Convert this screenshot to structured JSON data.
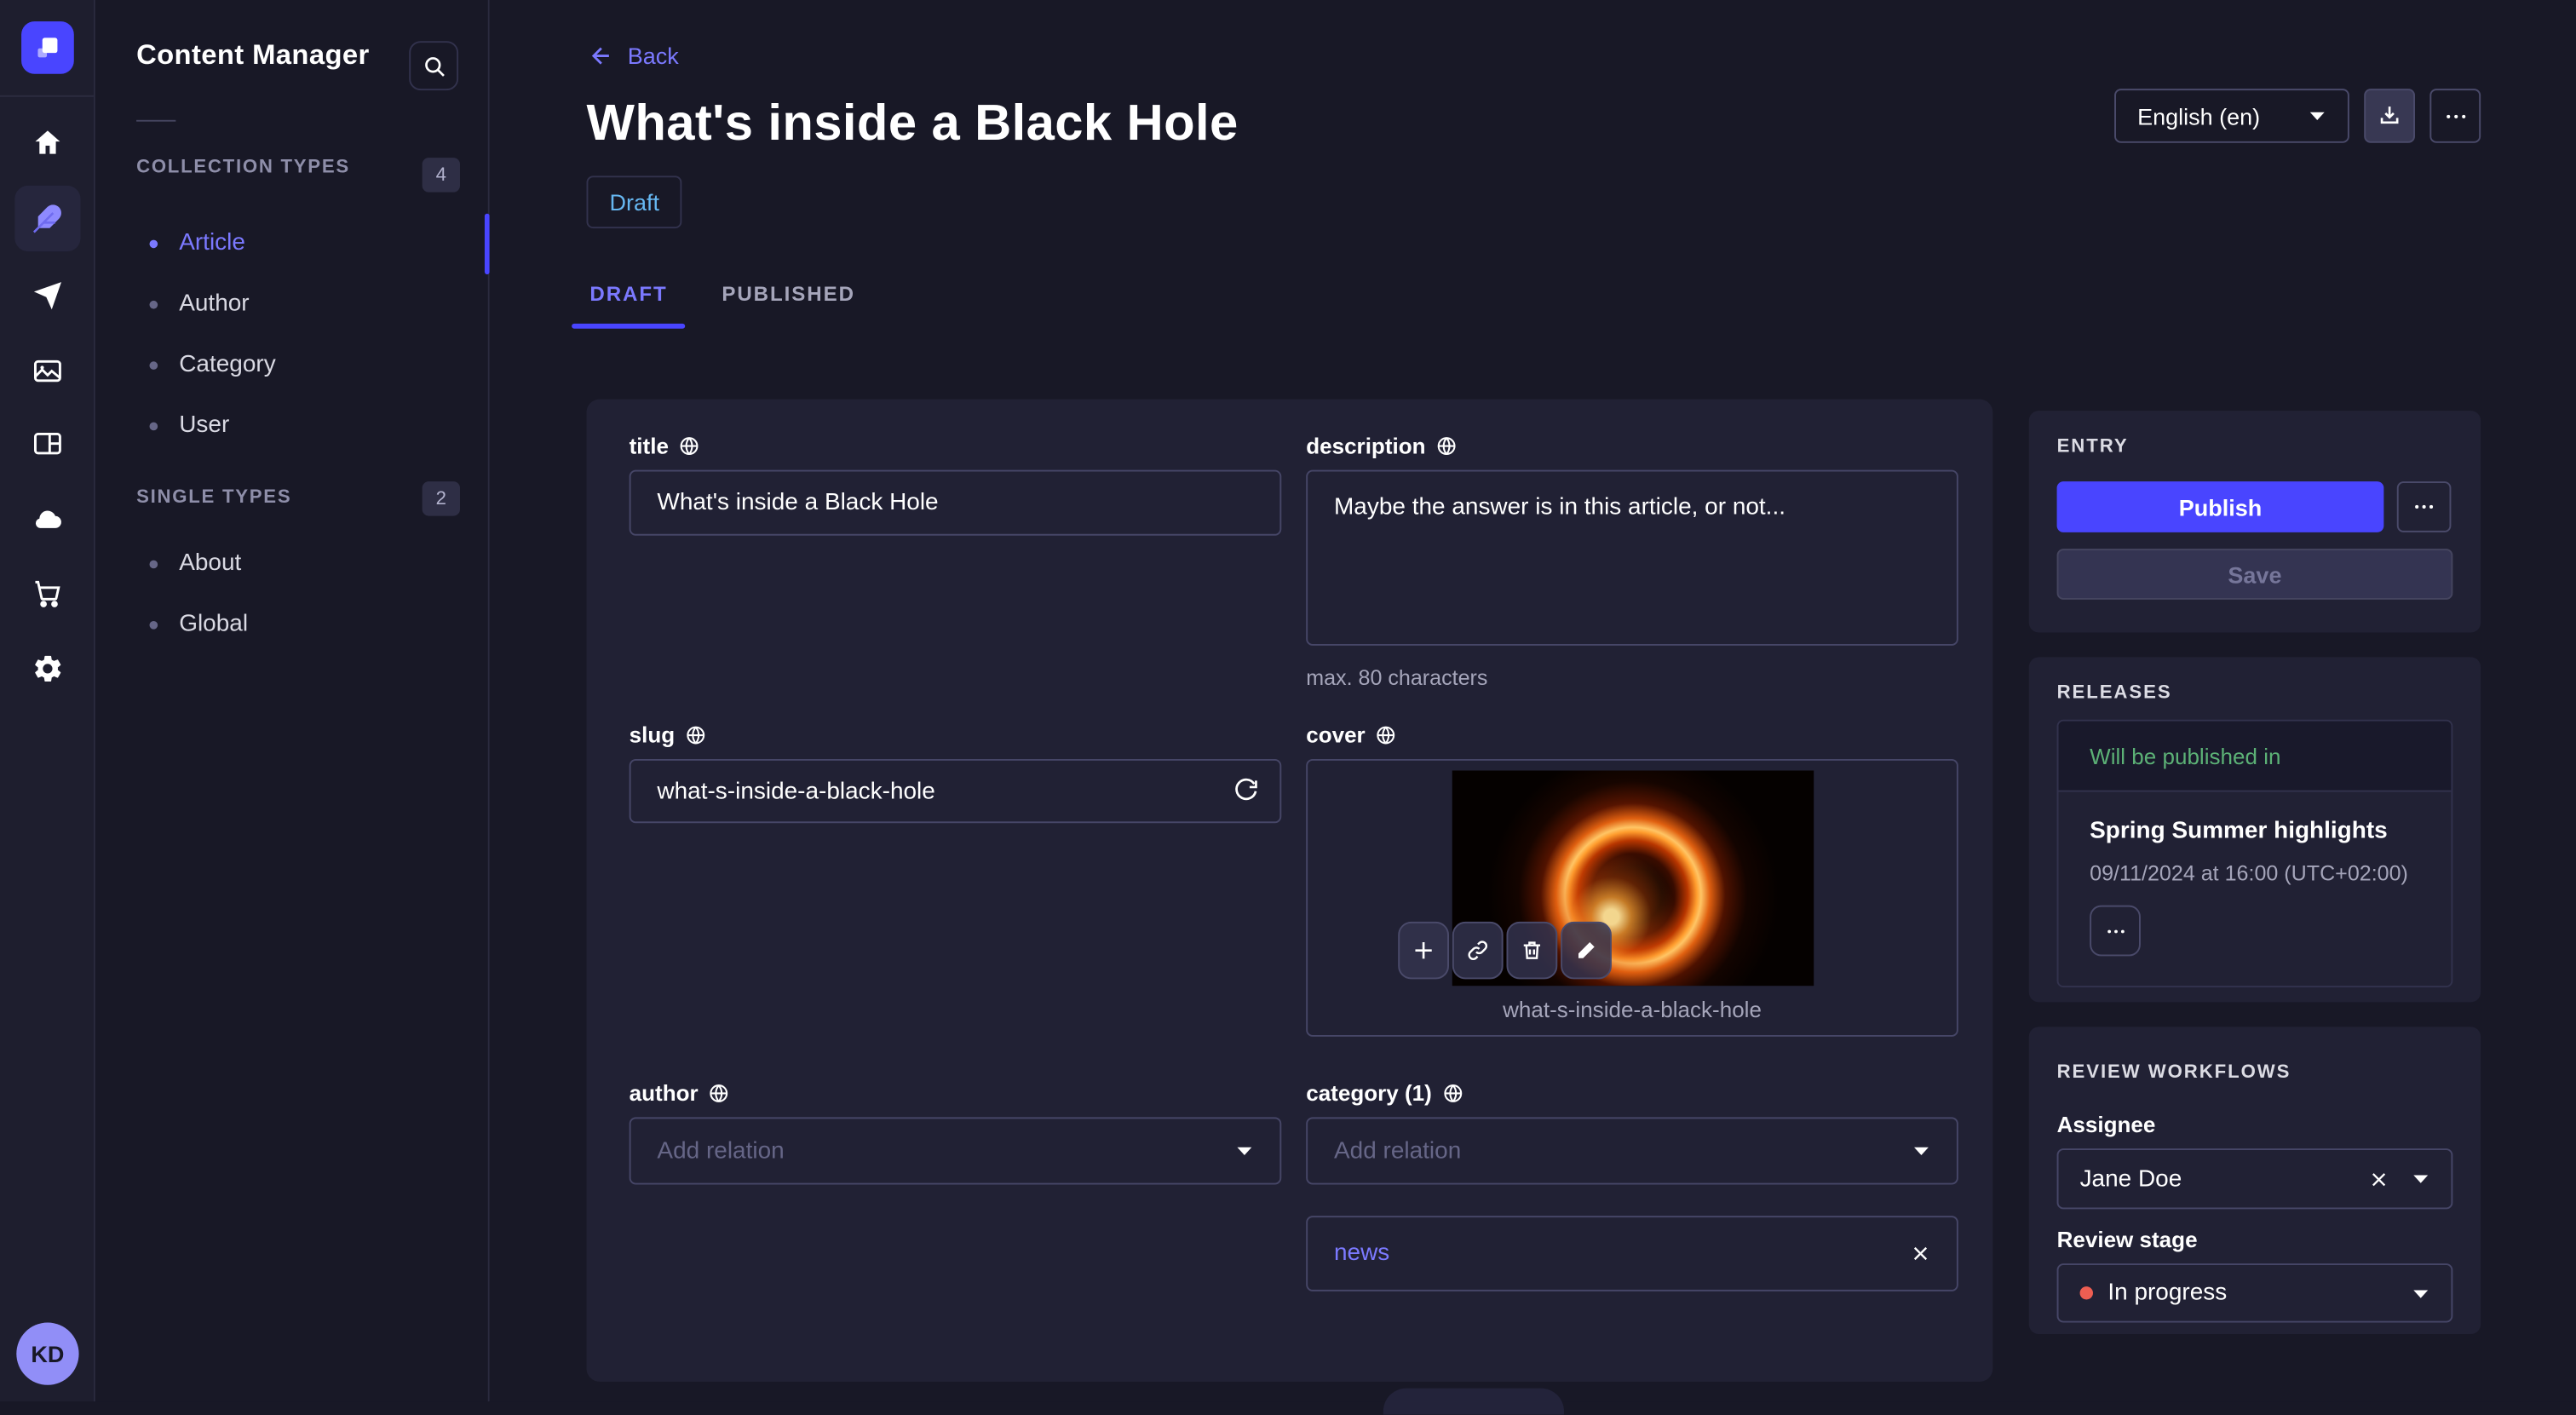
{
  "rail": {
    "items": [
      {
        "icon": "home-icon"
      },
      {
        "icon": "feather-icon",
        "active": true
      },
      {
        "icon": "paper-plane-icon"
      },
      {
        "icon": "media-images-icon"
      },
      {
        "icon": "layout-icon"
      },
      {
        "icon": "cloud-icon"
      },
      {
        "icon": "cart-icon"
      },
      {
        "icon": "gear-icon"
      }
    ],
    "avatar_initials": "KD"
  },
  "subnav": {
    "title": "Content Manager",
    "collection_types": {
      "label": "COLLECTION TYPES",
      "count": "4",
      "items": [
        {
          "label": "Article",
          "active": true
        },
        {
          "label": "Author"
        },
        {
          "label": "Category"
        },
        {
          "label": "User"
        }
      ]
    },
    "single_types": {
      "label": "SINGLE TYPES",
      "count": "2",
      "items": [
        {
          "label": "About"
        },
        {
          "label": "Global"
        }
      ]
    }
  },
  "header": {
    "back_label": "Back",
    "title": "What's inside a Black Hole",
    "status_badge": "Draft",
    "tabs": [
      {
        "label": "DRAFT",
        "active": true
      },
      {
        "label": "PUBLISHED"
      }
    ],
    "locale": "English (en)"
  },
  "form": {
    "title": {
      "label": "title",
      "value": "What's inside a Black Hole"
    },
    "description": {
      "label": "description",
      "value": "Maybe the answer is in this article, or not...",
      "hint": "max. 80 characters"
    },
    "slug": {
      "label": "slug",
      "value": "what-s-inside-a-black-hole"
    },
    "cover": {
      "label": "cover",
      "caption": "what-s-inside-a-black-hole"
    },
    "author": {
      "label": "author",
      "placeholder": "Add relation"
    },
    "category": {
      "label": "category (1)",
      "placeholder": "Add relation",
      "relations": [
        {
          "label": "news"
        }
      ]
    }
  },
  "entry_panel": {
    "title": "ENTRY",
    "publish_label": "Publish",
    "save_label": "Save"
  },
  "releases_panel": {
    "title": "RELEASES",
    "status": "Will be published in",
    "release_name": "Spring Summer highlights",
    "release_date": "09/11/2024 at 16:00 (UTC+02:00)"
  },
  "review_panel": {
    "title": "REVIEW WORKFLOWS",
    "assignee_label": "Assignee",
    "assignee_value": "Jane Doe",
    "stage_label": "Review stage",
    "stage_value": "In progress",
    "stage_dot_color": "#ee5e52"
  },
  "colors": {
    "accent": "#4945ff",
    "link_purple": "#7b79ff",
    "draft_blue": "#66b7f1",
    "release_green": "#5cb176",
    "stage_red": "#ee5e52",
    "surface": "#212134",
    "background": "#181826"
  }
}
